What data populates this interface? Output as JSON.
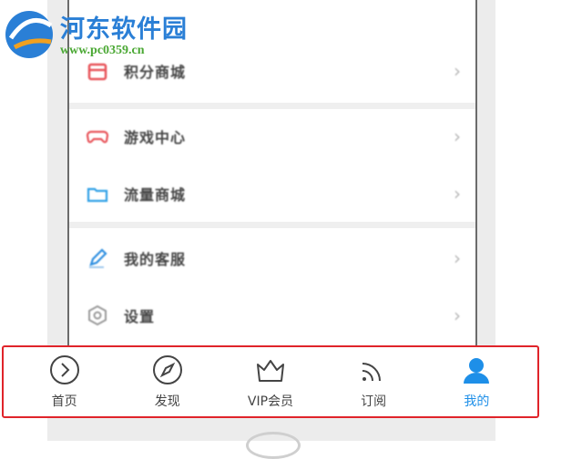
{
  "watermark": {
    "title": "河东软件园",
    "url": "www.pc0359.cn"
  },
  "menu": {
    "items": [
      {
        "label": "积分商城",
        "icon": "gift-box-icon",
        "color": "#e8545a"
      },
      {
        "label": "游戏中心",
        "icon": "gamepad-icon",
        "color": "#e8545a"
      },
      {
        "label": "流量商城",
        "icon": "folder-icon",
        "color": "#2fa0e6"
      },
      {
        "label": "我的客服",
        "icon": "pen-icon",
        "color": "#2f8fe0"
      },
      {
        "label": "设置",
        "icon": "settings-icon",
        "color": "#9a9a9a"
      }
    ],
    "chevron": "›"
  },
  "tabbar": {
    "tabs": [
      {
        "label": "首页",
        "icon": "play-circle-icon",
        "active": false
      },
      {
        "label": "发现",
        "icon": "compass-icon",
        "active": false
      },
      {
        "label": "VIP会员",
        "icon": "crown-icon",
        "active": false
      },
      {
        "label": "订阅",
        "icon": "rss-icon",
        "active": false
      },
      {
        "label": "我的",
        "icon": "user-icon",
        "active": true
      }
    ],
    "active_color": "#1e8fe8",
    "highlight_border_color": "#e0242a"
  }
}
